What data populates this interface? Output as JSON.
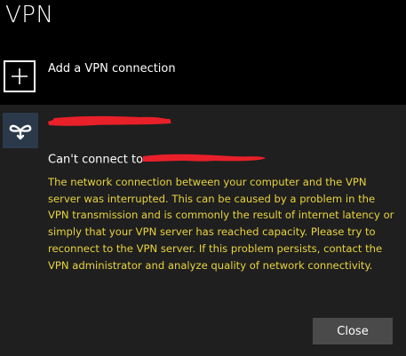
{
  "page": {
    "title": "VPN"
  },
  "add_connection": {
    "label": "Add a VPN connection",
    "icon": "plus-icon"
  },
  "connection": {
    "logo_icon": "vpn-logo-icon",
    "name_redacted": true,
    "error_title_prefix": "Can't connect to",
    "error_message": "The network connection between your computer and the VPN server was interrupted.  This can be caused by a problem in the VPN transmission and is commonly the result of internet latency or simply that your VPN server has reached capacity.  Please try to reconnect to the VPN server.  If this problem persists, contact the VPN administrator and analyze quality of network connectivity.",
    "close_label": "Close"
  },
  "colors": {
    "background": "#000000",
    "panel": "#1f1f1f",
    "error_text": "#e8d33f",
    "button": "#4a4a4a",
    "redaction": "#e8202a"
  }
}
